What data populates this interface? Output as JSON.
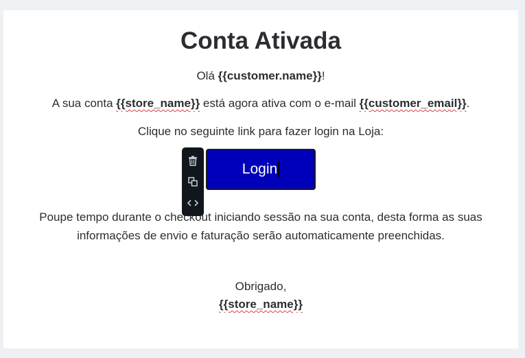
{
  "email": {
    "title": "Conta Ativada",
    "greeting": {
      "prefix": "Olá ",
      "variable": "{{customer.name}}",
      "suffix": "!"
    },
    "activated": {
      "part1": "A sua conta ",
      "store_var": "{{store_name}}",
      "part2": " está agora ativa com o e-mail ",
      "email_var": "{{customer_email}}",
      "part3": "."
    },
    "click_link": "Clique no seguinte link para fazer login na Loja:",
    "login_button": "Login",
    "paragraph": "Poupe tempo durante o checkout iniciando sessão na sua conta, desta forma as suas informações de envio e faturação serão automaticamente preenchidas.",
    "thanks": "Obrigado,",
    "signature": "{{store_name}}"
  },
  "toolbar": {
    "icons": [
      "trash-icon",
      "duplicate-icon",
      "code-icon"
    ]
  },
  "colors": {
    "button_bg": "#0000bb",
    "toolbar_bg": "#11151c",
    "text": "#2b2d31",
    "spell_underline": "#e03b3b"
  }
}
